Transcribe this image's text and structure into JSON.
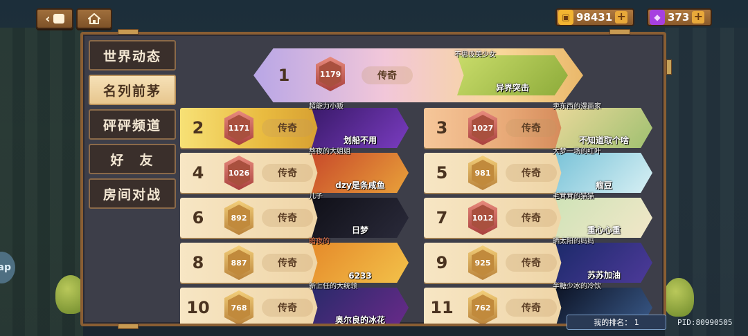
{
  "currency": {
    "coins": "98431",
    "gems": "373",
    "plus": "+"
  },
  "nav": {
    "back_icon": "back-arrow-icon",
    "home_icon": "home-icon"
  },
  "sidebar": {
    "tabs": [
      {
        "label": "世界动态",
        "active": false
      },
      {
        "label": "名列前茅",
        "active": true
      },
      {
        "label": "砰砰频道",
        "active": false
      },
      {
        "label": "好　友",
        "active": false
      },
      {
        "label": "房间对战",
        "active": false
      }
    ]
  },
  "leaderboard": {
    "first": {
      "rank": "1",
      "score": "1179",
      "tier": "传奇",
      "player": "不思议美少女",
      "card": "异界突击"
    },
    "rows": [
      {
        "rank": "2",
        "score": "1171",
        "tier": "传奇",
        "player": "超能力小贩",
        "card": "划船不用"
      },
      {
        "rank": "3",
        "score": "1027",
        "tier": "传奇",
        "player": "卖东西的漫画家",
        "card": "不知道取个啥"
      },
      {
        "rank": "4",
        "score": "1026",
        "tier": "传奇",
        "player": "熬夜的大姐姐",
        "card": "dzy是条咸鱼"
      },
      {
        "rank": "5",
        "score": "981",
        "tier": "传奇",
        "player": "大梦一场的红叶",
        "card": "痼豆"
      },
      {
        "rank": "6",
        "score": "892",
        "tier": "传奇",
        "player": "儿子",
        "card": "日梦"
      },
      {
        "rank": "7",
        "score": "1012",
        "tier": "传奇",
        "player": "毛茸茸的猫猫",
        "card": "重心心重"
      },
      {
        "rank": "8",
        "score": "887",
        "tier": "传奇",
        "player": "暗夜的",
        "card": "6233"
      },
      {
        "rank": "9",
        "score": "925",
        "tier": "传奇",
        "player": "晒太阳的妈妈",
        "card": "苏苏加油"
      },
      {
        "rank": "10",
        "score": "768",
        "tier": "传奇",
        "player": "新上任的大统领",
        "card": "奥尔良的冰花"
      },
      {
        "rank": "11",
        "score": "762",
        "tier": "传奇",
        "player": "半糖少冰的冷饮",
        "card": ""
      }
    ]
  },
  "footer": {
    "my_rank": "我的排名： 1",
    "pid": "PID:80990505"
  },
  "colors": {
    "frame": "#8a5e33",
    "accent": "#e9a93a",
    "gem": "#a640e0"
  }
}
